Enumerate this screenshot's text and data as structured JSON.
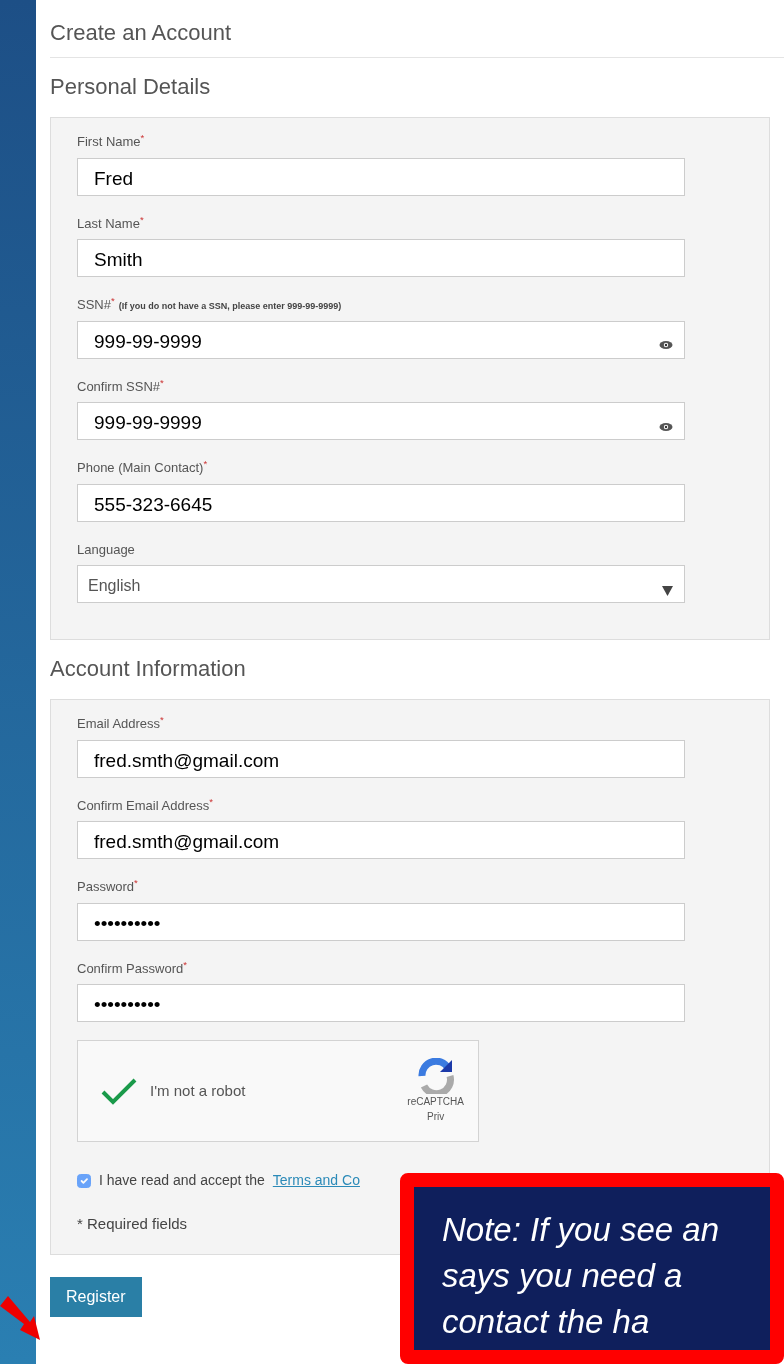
{
  "page_title": "Create an Account",
  "sections": [
    {
      "title": "Personal Details",
      "fields": [
        {
          "kind": "text",
          "label": "First Name$^{*}$",
          "value": "Fred"
        },
        {
          "kind": "text",
          "label": "Last Name$^{*}$",
          "value": "Smith"
        },
        {
          "kind": "secret",
          "label": "SSN#$^{*}$",
          "hint": "(If you do not have a SSN, please enter 999-99-9999)",
          "value": "999-99-9999"
        },
        {
          "kind": "secret",
          "label": "Confirm SSN#$^{*}$",
          "value": "999-99-9999"
        },
        {
          "kind": "text",
          "label": "Phone (Main Contact)$^{*}$",
          "value": "555-323-6645"
        },
        {
          "kind": "select",
          "label": "Language",
          "value": "English"
        }
      ]
    },
    {
      "title": "Account Information",
      "fields": [
        {
          "kind": "text",
          "label": "Email Address$^{*}$",
          "value": "fred.smth@gmail.com"
        },
        {
          "kind": "text",
          "label": "Confirm Email Address$^{*}$",
          "value": "fred.smth@gmail.com"
        },
        {
          "kind": "text",
          "label": "Password$^{*}$",
          "value": "••••••••••"
        },
        {
          "kind": "text",
          "label": "Confirm Password$^{*}$",
          "value": "••••••••••"
        }
      ],
      "captcha": {
        "label": "I'm not a robot",
        "checked": true,
        "brand": "reCAPTCHA",
        "privacy": "Priv"
      },
      "terms": {
        "checked": true,
        "text": "I have read and accept the",
        "link": "Terms and Co"
      },
      "required_note": "* Required fields"
    }
  ],
  "register_button": "Register",
  "note": {
    "lines": [
      "Note: If you see an",
      "says you need a",
      "contact the ha"
    ]
  }
}
